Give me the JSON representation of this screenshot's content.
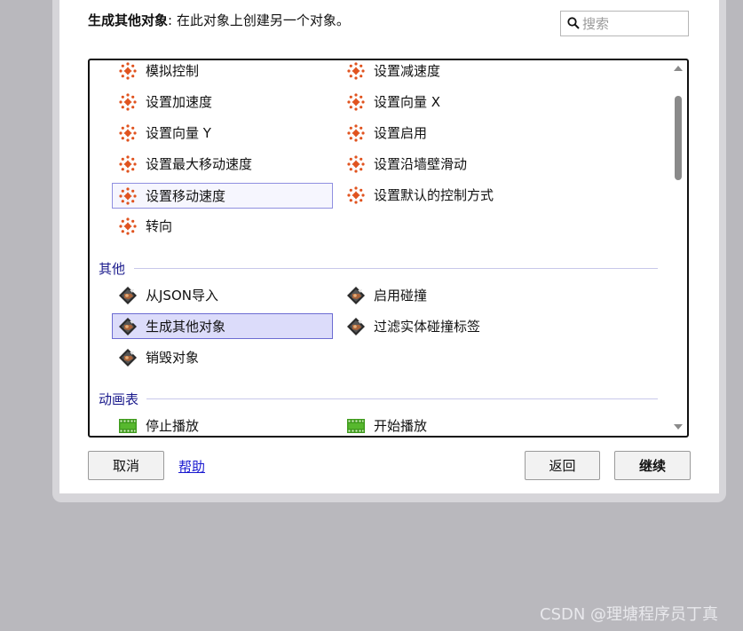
{
  "header": {
    "title_bold": "生成其他对象",
    "title_rest": ": 在此对象上创建另一个对象。"
  },
  "search": {
    "placeholder": "搜索",
    "icon": "search-icon"
  },
  "sections": [
    {
      "name": "",
      "icon": "movement-behavior-icon",
      "items": [
        "模拟控制",
        "设置减速度",
        "设置加速度",
        "设置向量 X",
        "设置向量 Y",
        "设置启用",
        "设置最大移动速度",
        "设置沿墙壁滑动",
        "设置移动速度",
        "设置默认的控制方式",
        "转向"
      ]
    },
    {
      "name": "其他",
      "icon": "object-misc-icon",
      "items": [
        "从JSON导入",
        "启用碰撞",
        "生成其他对象",
        "过滤实体碰撞标签",
        "销毁对象"
      ]
    },
    {
      "name": "动画表",
      "icon": "animation-film-icon",
      "items": [
        "停止播放",
        "开始播放"
      ]
    }
  ],
  "hovered_item": "设置移动速度",
  "selected_item": "生成其他对象",
  "buttons": {
    "cancel": "取消",
    "help": "帮助",
    "back": "返回",
    "continue": "继续"
  },
  "watermark": "CSDN @理塘程序员丁真",
  "colors": {
    "accent_orange": "#e0531f",
    "selection": "#dcdcfa",
    "link": "#1a1ad0",
    "category_text": "#1a1a8c",
    "film_green": "#3f9b1d"
  }
}
